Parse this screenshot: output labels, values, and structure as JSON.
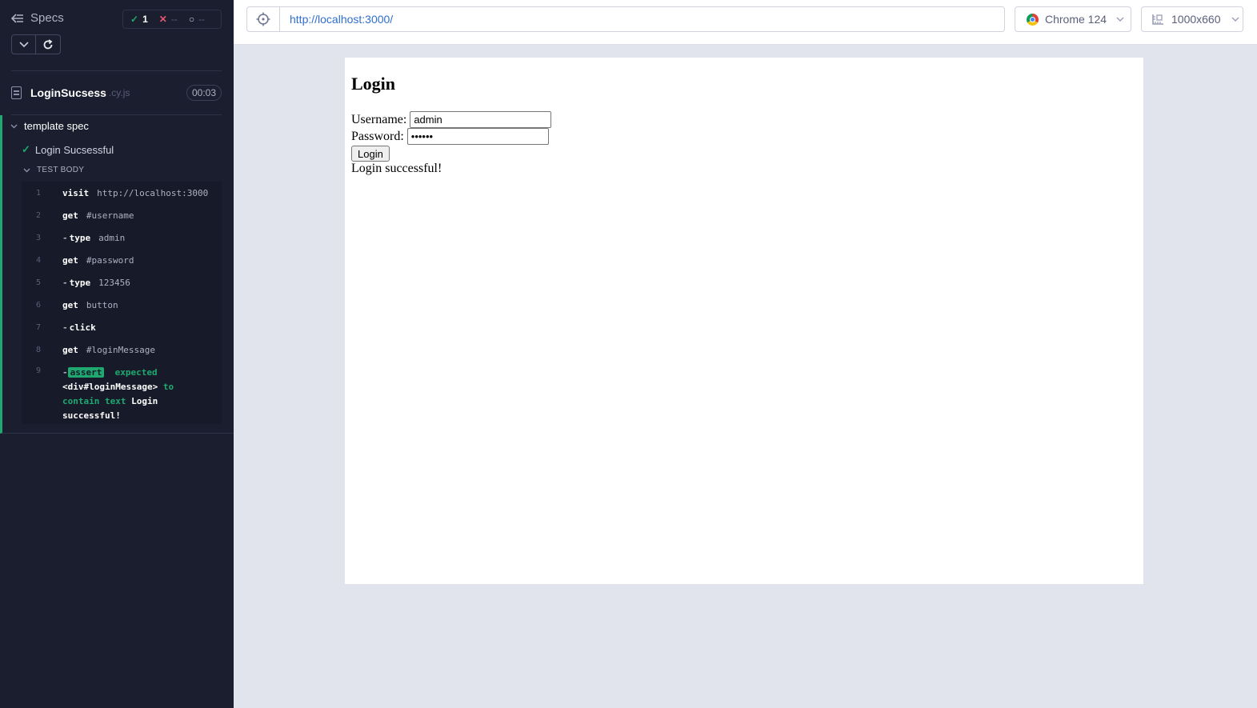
{
  "reporter": {
    "specs_label": "Specs",
    "stats": {
      "passed": "1",
      "failed": "--",
      "pending": "--"
    },
    "spec": {
      "name": "LoginSucsess",
      "ext": ".cy.js",
      "duration": "00:03"
    },
    "suite": {
      "title": "template spec"
    },
    "test": {
      "title": "Login Sucsessful",
      "body_label": "TEST BODY"
    },
    "commands": [
      {
        "num": "1",
        "name": "visit",
        "arg": "http://localhost:3000",
        "child": false
      },
      {
        "num": "2",
        "name": "get",
        "arg": "#username",
        "child": false
      },
      {
        "num": "3",
        "name": "type",
        "arg": "admin",
        "child": true
      },
      {
        "num": "4",
        "name": "get",
        "arg": "#password",
        "child": false
      },
      {
        "num": "5",
        "name": "type",
        "arg": "123456",
        "child": true
      },
      {
        "num": "6",
        "name": "get",
        "arg": "button",
        "child": false
      },
      {
        "num": "7",
        "name": "click",
        "arg": "",
        "child": true
      },
      {
        "num": "8",
        "name": "get",
        "arg": "#loginMessage",
        "child": false
      }
    ],
    "assertion": {
      "num": "9",
      "badge": "assert",
      "part1": "expected",
      "target": "<div#loginMessage>",
      "part2": "to contain text",
      "value": "Login successful!"
    }
  },
  "topbar": {
    "url": "http://localhost:3000/",
    "browser": "Chrome 124",
    "viewport": "1000x660"
  },
  "app": {
    "heading": "Login",
    "username_label": "Username:",
    "username_value": "admin",
    "password_label": "Password:",
    "password_value": "123456",
    "login_button": "Login",
    "message": "Login successful!"
  },
  "colors": {
    "sidebar_bg": "#1b1e2e",
    "pass_green": "#1fa971",
    "fail_red": "#e45770",
    "url_blue": "#2f6fd1",
    "canvas_bg": "#e1e3ed"
  },
  "icons": [
    "back-arrow-icon",
    "check-icon",
    "x-icon",
    "spinner-icon",
    "chevron-down-icon",
    "reload-icon",
    "file-icon",
    "crosshair-icon",
    "chrome-icon",
    "ruler-icon"
  ]
}
